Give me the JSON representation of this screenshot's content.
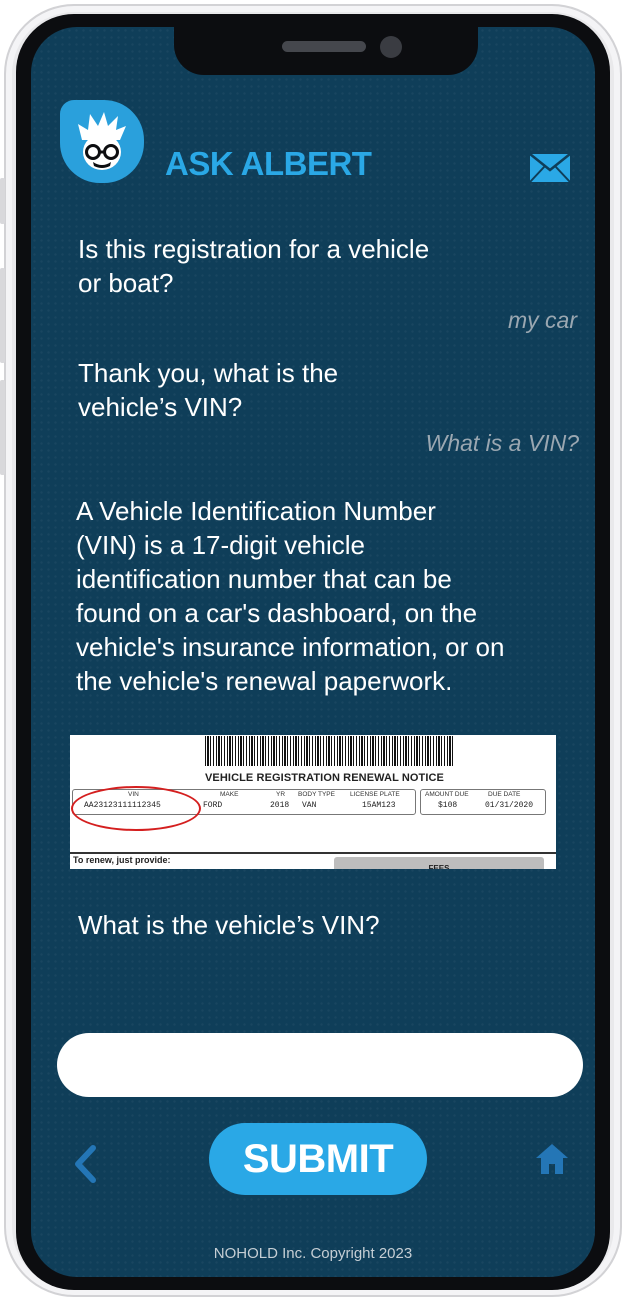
{
  "app": {
    "title": "ASK ALBERT",
    "logo_icon": "albert-avatar-icon",
    "mail_icon": "envelope-icon"
  },
  "chat": {
    "q1": {
      "line1": "Is this registration for a vehicle",
      "line2": "or boat?"
    },
    "a1": "my car",
    "q2": {
      "line1": "Thank you, what is the",
      "line2": "vehicle’s VIN?"
    },
    "a2": "What is a VIN?",
    "explanation": [
      "A Vehicle Identification Number",
      "(VIN) is a 17-digit vehicle",
      "identification number that can be",
      "found on a car's dashboard, on the",
      "vehicle's insurance information, or on",
      "the vehicle's renewal paperwork."
    ],
    "q3": "What is the vehicle’s VIN?"
  },
  "notice": {
    "title": "VEHICLE REGISTRATION RENEWAL NOTICE",
    "headers": {
      "vin": "VIN",
      "make": "MAKE",
      "yr": "YR",
      "body": "BODY TYPE",
      "plate": "LICENSE PLATE",
      "amount": "AMOUNT DUE",
      "due": "DUE DATE"
    },
    "values": {
      "vin": "AA23123111112345",
      "make": "FORD",
      "yr": "2018",
      "body": "VAN",
      "plate": "15AM123",
      "amount": "$108",
      "due": "01/31/2020"
    },
    "renew_text": "To renew, just provide:",
    "fees_label": "FEES"
  },
  "input": {
    "value": "",
    "placeholder": ""
  },
  "nav": {
    "back_icon": "chevron-left-icon",
    "submit_label": "SUBMIT",
    "home_icon": "home-icon"
  },
  "footer": "NOHOLD Inc. Copyright 2023",
  "colors": {
    "screen_bg": "#0f3e59",
    "accent": "#2aa8e6",
    "reply_text": "#9aa7b1"
  }
}
